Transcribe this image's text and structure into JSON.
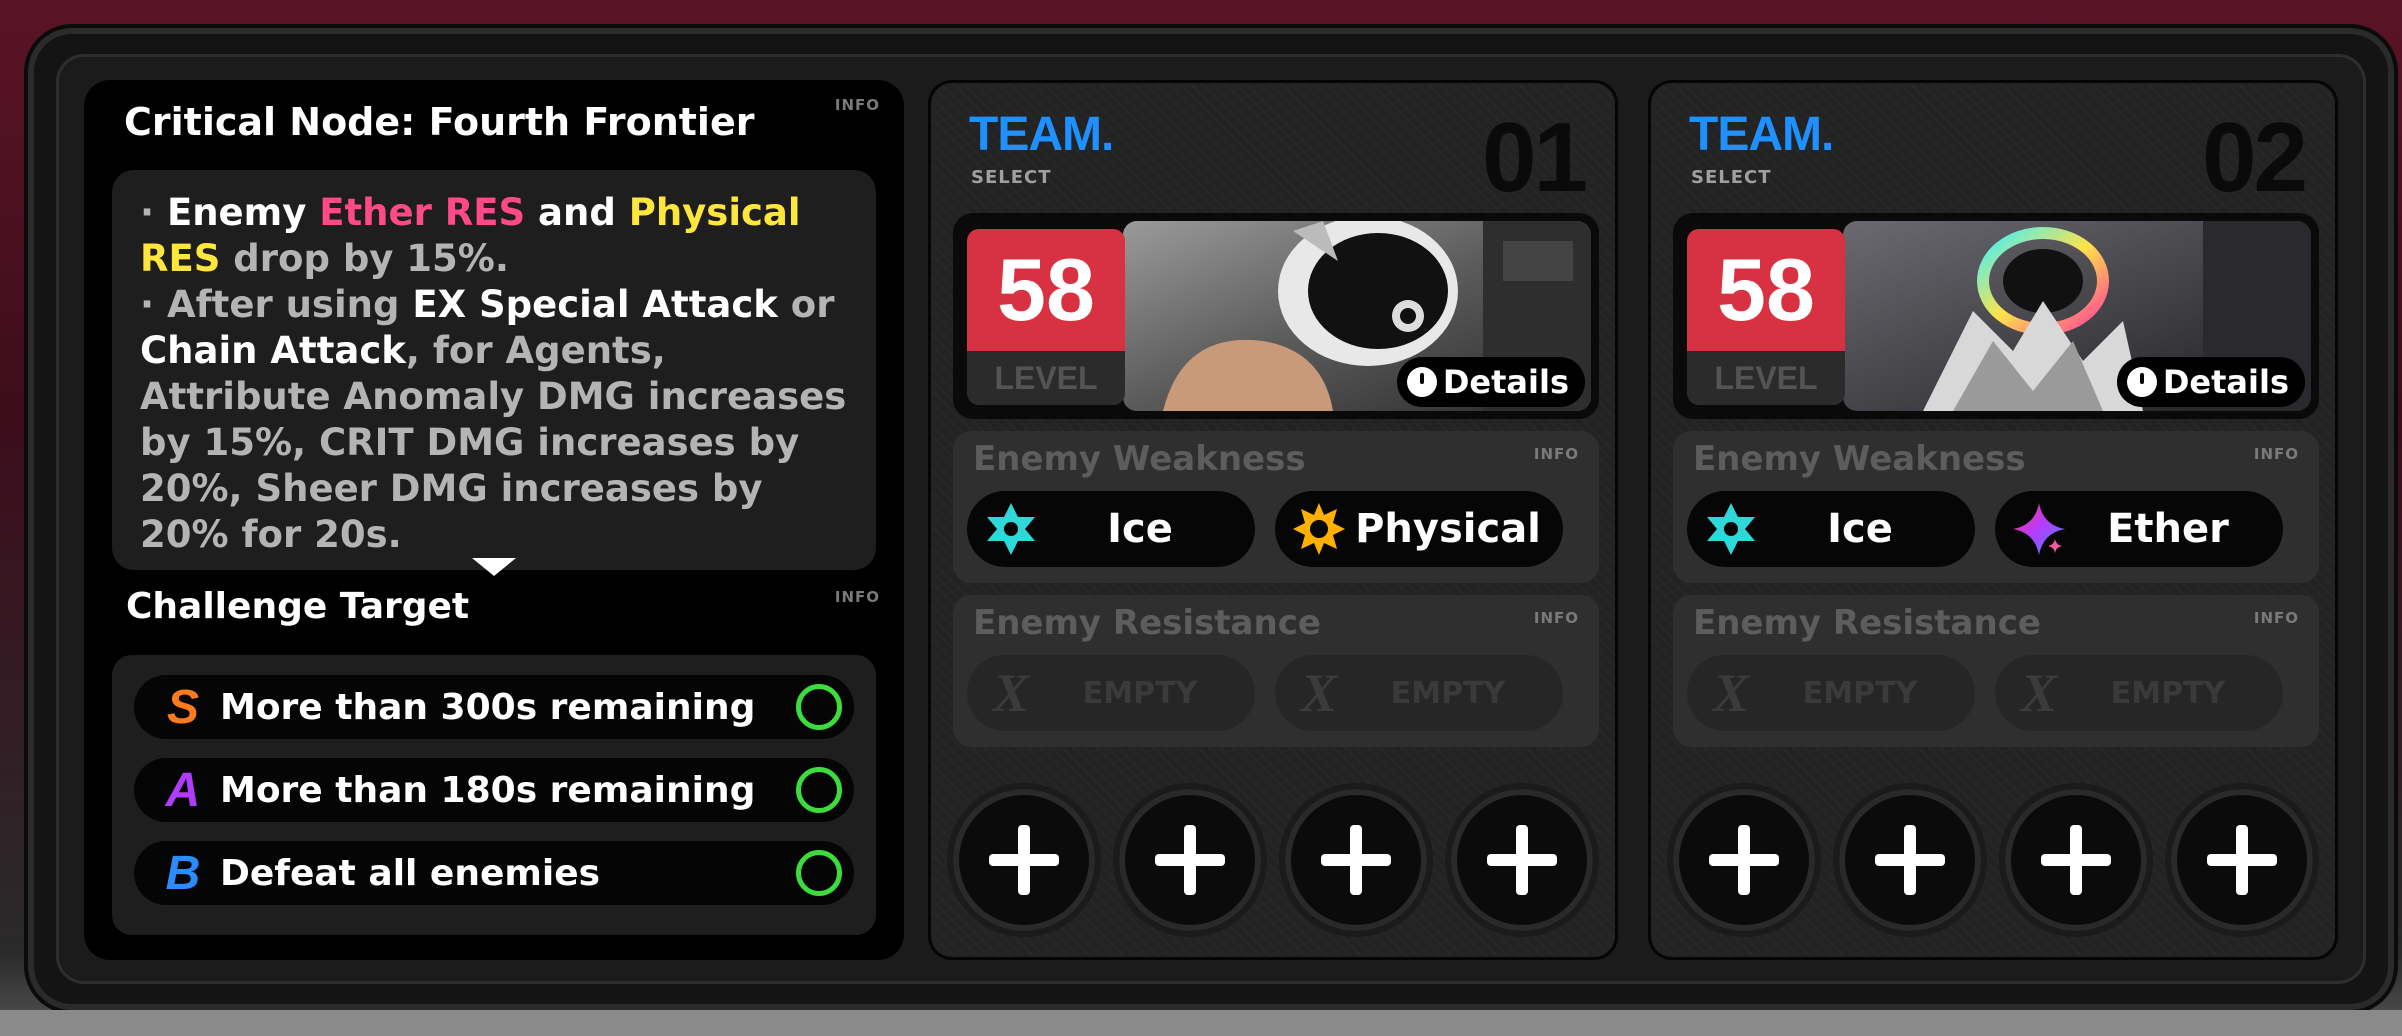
{
  "node": {
    "title": "Critical Node: Fourth Frontier",
    "info": "INFO",
    "desc": {
      "b1_bullet": "· ",
      "b1_a": "Enemy ",
      "b1_ether": "Ether RES",
      "b1_and": " and ",
      "b1_phys": "Physical RES",
      "b1_tail": " drop by 15%.",
      "b2_bullet": "· ",
      "b2_a": "After using ",
      "b2_ex": "EX Special Attack",
      "b2_or": " or ",
      "b2_chain": "Chain Attack",
      "b2_tail": ", for Agents, Attribute Anomaly DMG increases by 15%, CRIT DMG increases by 20%, Sheer DMG increases by 20% for 20s."
    }
  },
  "challenge": {
    "title": "Challenge Target",
    "info": "INFO",
    "targets": [
      {
        "rank": "S",
        "text": "More than 300s remaining",
        "color": "#ff7a1a"
      },
      {
        "rank": "A",
        "text": "More than 180s remaining",
        "color": "#b03cff"
      },
      {
        "rank": "B",
        "text": "Defeat all enemies",
        "color": "#2a8cff"
      }
    ]
  },
  "teams": [
    {
      "word": "TEAM.",
      "sub": "SELECT",
      "num": "01",
      "level": "58",
      "level_label": "LEVEL",
      "details": "Details",
      "weakness_title": "Enemy Weakness",
      "weakness": [
        "Ice",
        "Physical"
      ],
      "weakness_icons": [
        "ice-icon",
        "physical-icon"
      ],
      "resistance_title": "Enemy Resistance",
      "resistance": [
        "EMPTY",
        "EMPTY"
      ],
      "info": "INFO"
    },
    {
      "word": "TEAM.",
      "sub": "SELECT",
      "num": "02",
      "level": "58",
      "level_label": "LEVEL",
      "details": "Details",
      "weakness_title": "Enemy Weakness",
      "weakness": [
        "Ice",
        "Ether"
      ],
      "weakness_icons": [
        "ice-icon",
        "ether-icon"
      ],
      "resistance_title": "Enemy Resistance",
      "resistance": [
        "EMPTY",
        "EMPTY"
      ],
      "info": "INFO"
    }
  ],
  "colors": {
    "accent_blue": "#1e90ff",
    "level_red": "#d83242",
    "ether_pink": "#ff4a8a",
    "physical_yellow": "#ffe63c",
    "check_green": "#3ddc3d"
  }
}
